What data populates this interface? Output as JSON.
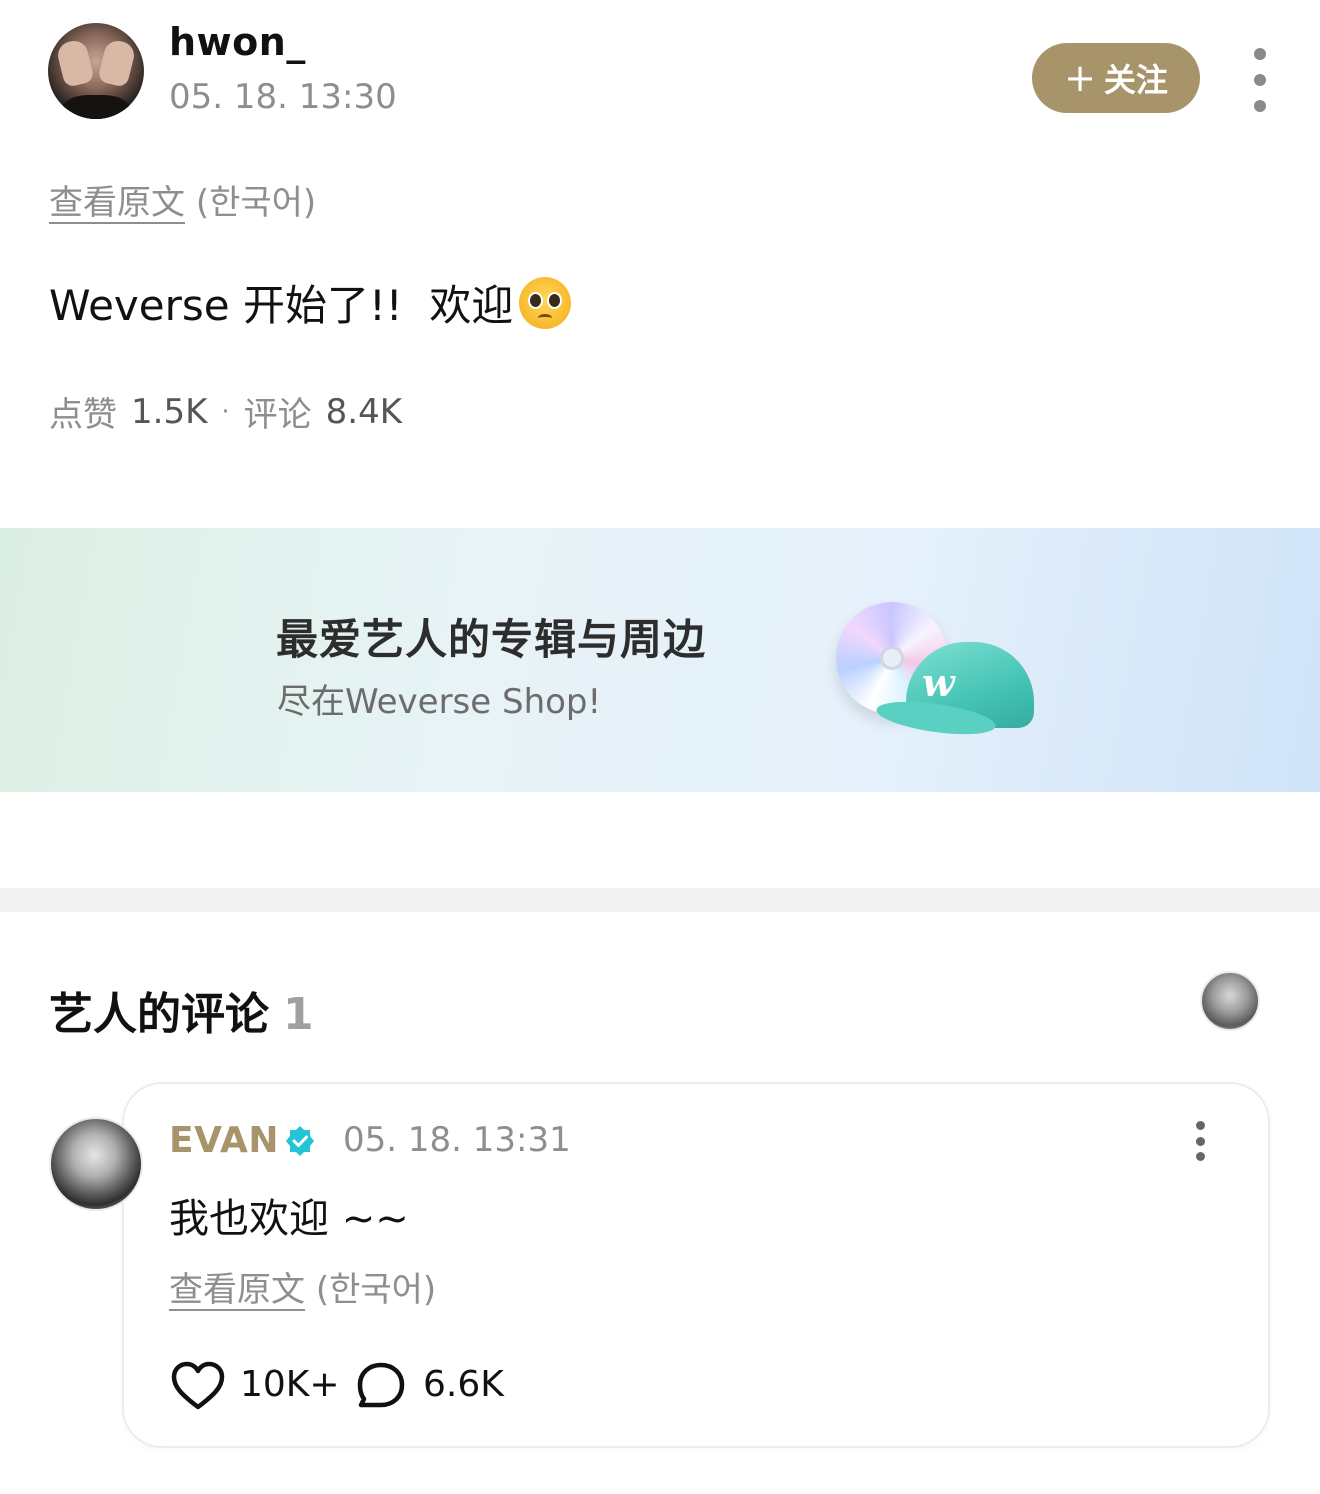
{
  "post": {
    "username": "hwon_",
    "time": "05. 18. 13:30",
    "follow_label": "关注",
    "view_original_link": "查看原文",
    "view_original_lang": "(한국어)",
    "body_text": "Weverse 开始了!!  欢迎",
    "emoji": "pleading-face",
    "likes_label": "点赞",
    "likes_count": "1.5K",
    "stat_separator": "·",
    "comments_label": "评论",
    "comments_count": "8.4K"
  },
  "banner": {
    "title": "最爱艺人的专辑与周边",
    "subtitle": "尽在Weverse Shop!",
    "cap_logo": "w"
  },
  "artist_comments": {
    "title": "艺人的评论",
    "count": "1",
    "comment": {
      "author": "EVAN",
      "time": "05. 18. 13:31",
      "text": "我也欢迎 ~~",
      "view_original_link": "查看原文",
      "view_original_lang": "(한국어)",
      "likes": "10K+",
      "replies": "6.6K"
    }
  },
  "colors": {
    "accent": "#a8946a",
    "verified": "#25c3d6",
    "muted_text": "#8e8e8e"
  }
}
